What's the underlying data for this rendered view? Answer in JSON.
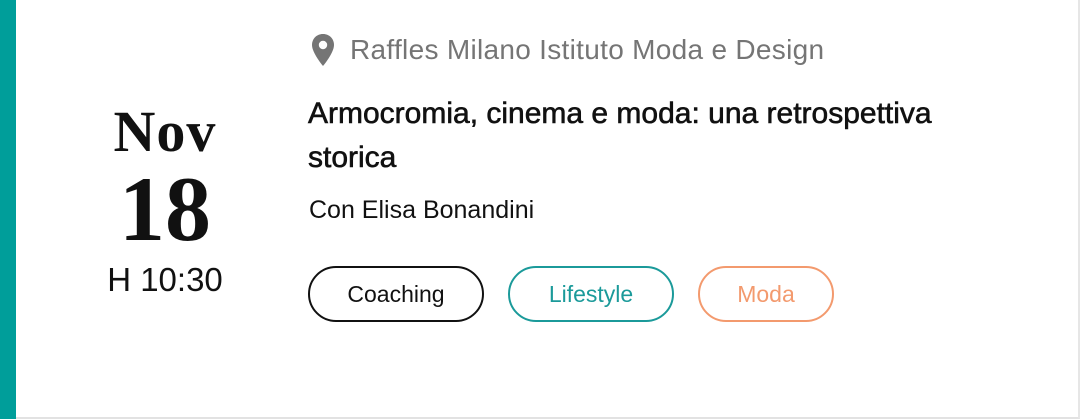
{
  "event": {
    "date": {
      "month": "Nov",
      "day": "18",
      "time": "H 10:30"
    },
    "location": {
      "icon": "map-pin-icon",
      "text": "Raffles Milano Istituto Moda e Design"
    },
    "title": "Armocromia, cinema e moda: una retrospettiva storica",
    "speaker": "Con Elisa Bonandini",
    "tags": [
      {
        "label": "Coaching",
        "color": "#111111"
      },
      {
        "label": "Lifestyle",
        "color": "#1b9a9a"
      },
      {
        "label": "Moda",
        "color": "#f39a6e"
      }
    ]
  },
  "colors": {
    "accent": "#009e9a",
    "location_text": "#757575",
    "text": "#111111"
  }
}
